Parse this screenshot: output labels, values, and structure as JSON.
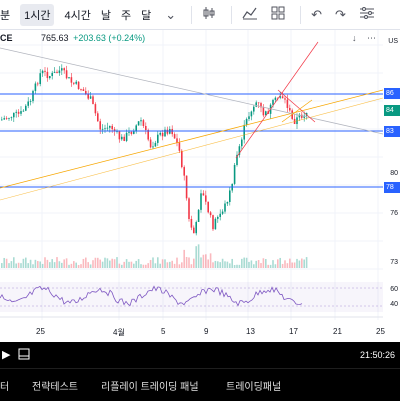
{
  "toolbar": {
    "intervals": [
      {
        "label": "분",
        "active": false
      },
      {
        "label": "1시간",
        "active": true
      },
      {
        "label": "4시간",
        "active": false
      },
      {
        "label": "날",
        "active": false
      },
      {
        "label": "주",
        "active": false
      },
      {
        "label": "달",
        "active": false
      }
    ],
    "dropdown_icon": "chevron-down-icon",
    "icons": [
      "candlestick-icon",
      "indicators-icon",
      "layout-icon",
      "undo-icon",
      "redo-icon",
      "settings-icon"
    ]
  },
  "legend": {
    "symbol_tail": "CE",
    "last_price": "765.63",
    "change": "+203.63 (+0.24%)"
  },
  "price_scale": {
    "ticks": [
      "86",
      "84",
      "83",
      "80",
      "78",
      "76",
      "73"
    ],
    "indicator_ticks": [
      "60",
      "40"
    ],
    "currency_label": "US",
    "labels": [
      {
        "text": "86",
        "color": "#2962ff"
      },
      {
        "text": "84",
        "color": "#089981"
      },
      {
        "text": "83",
        "color": "#2962ff"
      },
      {
        "text": "78",
        "color": "#2962ff"
      }
    ]
  },
  "corner": {
    "down_arrow": "↓",
    "menu": "⋯"
  },
  "date_axis": [
    "25",
    "4월",
    "5",
    "9",
    "13",
    "17",
    "21",
    "25"
  ],
  "bottom_bar": {
    "time": "21:50:26",
    "icons": [
      "play-icon",
      "fullscreen-icon"
    ]
  },
  "tabs": [
    "터",
    "전략테스트",
    "리플레이 트레이딩 패널",
    "트레이딩패널"
  ],
  "colors": {
    "up": "#089981",
    "down": "#f23645",
    "hline": "#2962ff",
    "trend_orange": "#f7a600",
    "trend_gray": "#b2b5be",
    "rsi": "#7e57c2"
  }
}
